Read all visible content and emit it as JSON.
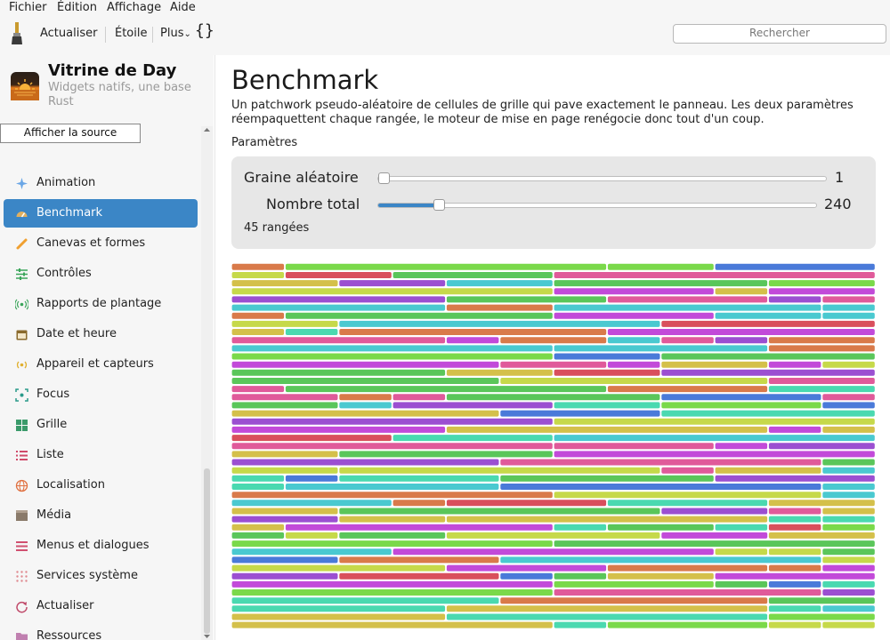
{
  "menu": [
    "Fichier",
    "Édition",
    "Affichage",
    "Aide"
  ],
  "toolbar": {
    "refresh": "Actualiser",
    "star": "Étoile",
    "more": "Plus",
    "more_chevron": "⌄",
    "braces": "{}"
  },
  "search": {
    "placeholder": "Rechercher"
  },
  "app": {
    "title": "Vitrine de Day",
    "subtitle": "Widgets natifs, une base Rust"
  },
  "tooltip": "Afficher la source",
  "nav": [
    {
      "label": "Animation",
      "icon": "sparkle-icon",
      "color": "#6aa6e6"
    },
    {
      "label": "Benchmark",
      "icon": "gauge-icon",
      "color": "#d89a3c",
      "active": true
    },
    {
      "label": "Canevas et formes",
      "icon": "brush-icon",
      "color": "#f0a030"
    },
    {
      "label": "Contrôles",
      "icon": "sliders-icon",
      "color": "#3aa55a"
    },
    {
      "label": "Rapports de plantage",
      "icon": "broadcast-icon",
      "color": "#3aa55a"
    },
    {
      "label": "Date et heure",
      "icon": "calendar-icon",
      "color": "#8a6a2c"
    },
    {
      "label": "Appareil et capteurs",
      "icon": "sensor-icon",
      "color": "#e0b030"
    },
    {
      "label": "Focus",
      "icon": "focus-icon",
      "color": "#2a9a8a"
    },
    {
      "label": "Grille",
      "icon": "grid-icon",
      "color": "#3a9a6a"
    },
    {
      "label": "Liste",
      "icon": "list-icon",
      "color": "#d04a6a"
    },
    {
      "label": "Localisation",
      "icon": "globe-icon",
      "color": "#e07040"
    },
    {
      "label": "Média",
      "icon": "film-icon",
      "color": "#8a7a6a"
    },
    {
      "label": "Menus et dialogues",
      "icon": "menu-icon",
      "color": "#d05070"
    },
    {
      "label": "Services système",
      "icon": "dots-grid-icon",
      "color": "#e08a90"
    },
    {
      "label": "Actualiser",
      "icon": "refresh-icon",
      "color": "#c04a6a"
    },
    {
      "label": "Ressources",
      "icon": "folder-icon",
      "color": "#c080b0"
    }
  ],
  "main": {
    "title": "Benchmark",
    "description": "Un patchwork pseudo-aléatoire de cellules de grille qui pave exactement le panneau. Les deux paramètres réempaquettent chaque rangée, le moteur de mise en page renégocie donc tout d'un coup.",
    "params_label": "Paramètres",
    "seed_label": "Graine aléatoire",
    "seed_value": "1",
    "seed_fraction": 0.0,
    "count_label": "Nombre total",
    "count_value": "240",
    "count_fraction": 0.13,
    "rows_text": "45 rangées"
  },
  "patchwork_palette": [
    "#d94f5c",
    "#5ac65a",
    "#9b4fd1",
    "#d4c04a",
    "#4ac9d0",
    "#c6d94a",
    "#e05a9a",
    "#4a7ad9",
    "#d97a4a",
    "#7ad94a",
    "#4ad9b0",
    "#c24ad9"
  ]
}
